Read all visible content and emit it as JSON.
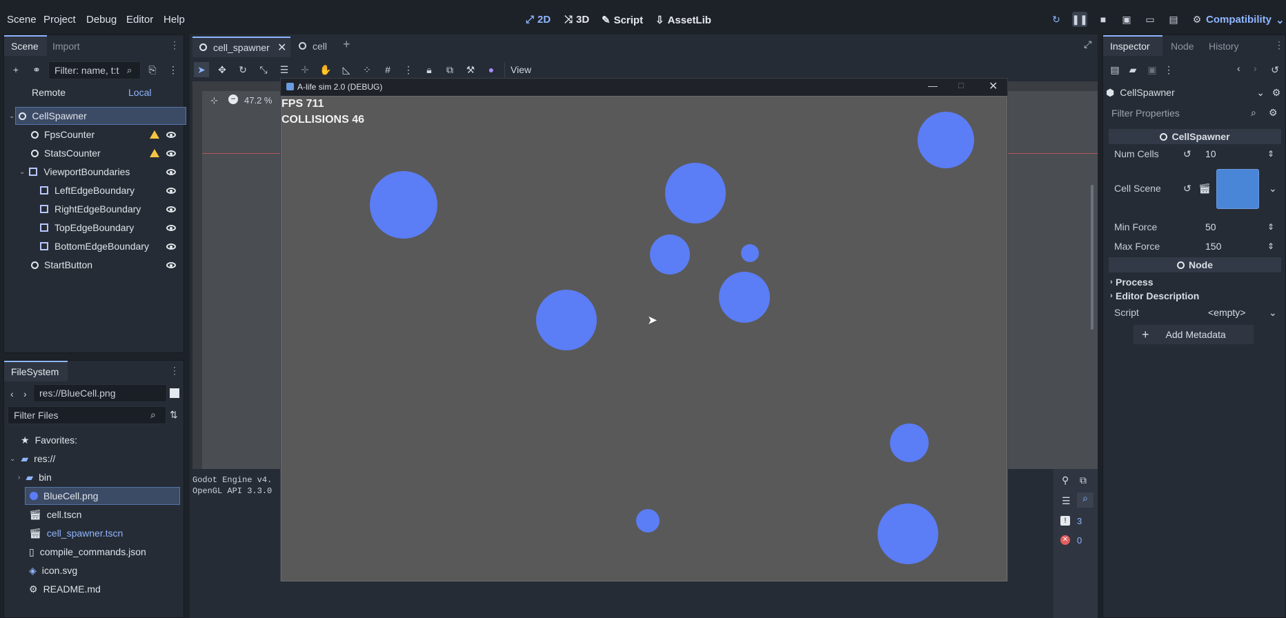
{
  "menu": {
    "scene": "Scene",
    "project": "Project",
    "debug": "Debug",
    "editor": "Editor",
    "help": "Help"
  },
  "workspaces": {
    "w2d": "2D",
    "w3d": "3D",
    "script": "Script",
    "assetlib": "AssetLib"
  },
  "renderer": "Compatibility",
  "scene_dock": {
    "tab_scene": "Scene",
    "tab_import": "Import",
    "filter_placeholder": "Filter: name, t:t",
    "remote": "Remote",
    "local": "Local",
    "nodes": [
      {
        "name": "CellSpawner"
      },
      {
        "name": "FpsCounter"
      },
      {
        "name": "StatsCounter"
      },
      {
        "name": "ViewportBoundaries"
      },
      {
        "name": "LeftEdgeBoundary"
      },
      {
        "name": "RightEdgeBoundary"
      },
      {
        "name": "TopEdgeBoundary"
      },
      {
        "name": "BottomEdgeBoundary"
      },
      {
        "name": "StartButton"
      }
    ]
  },
  "filesystem": {
    "title": "FileSystem",
    "path": "res://BlueCell.png",
    "filter_placeholder": "Filter Files",
    "items": [
      "Favorites:",
      "res://",
      "bin",
      "BlueCell.png",
      "cell.tscn",
      "cell_spawner.tscn",
      "compile_commands.json",
      "icon.svg",
      "README.md"
    ]
  },
  "editor_tabs": {
    "tab1": "cell_spawner",
    "tab2": "cell"
  },
  "viewport_toolbar": {
    "view": "View",
    "zoom": "47.2 %"
  },
  "game_window": {
    "title": "A-life sim 2.0 (DEBUG)",
    "fps": "FPS 711",
    "collisions": "COLLISIONS 46",
    "cell_color": "#5b7df5"
  },
  "output": {
    "line1": "Godot Engine v4.",
    "line2": "OpenGL API 3.3.0",
    "warn_count": "3",
    "error_count": "0"
  },
  "inspector": {
    "tab_inspector": "Inspector",
    "tab_node": "Node",
    "tab_history": "History",
    "object": "CellSpawner",
    "filter_placeholder": "Filter Properties",
    "section": "CellSpawner",
    "num_cells_label": "Num Cells",
    "num_cells": "10",
    "cell_scene_label": "Cell Scene",
    "min_force_label": "Min Force",
    "min_force": "50",
    "max_force_label": "Max Force",
    "max_force": "150",
    "node_section": "Node",
    "process": "Process",
    "editor_description": "Editor Description",
    "script_label": "Script",
    "script_value": "<empty>",
    "add_metadata": "Add Metadata"
  }
}
